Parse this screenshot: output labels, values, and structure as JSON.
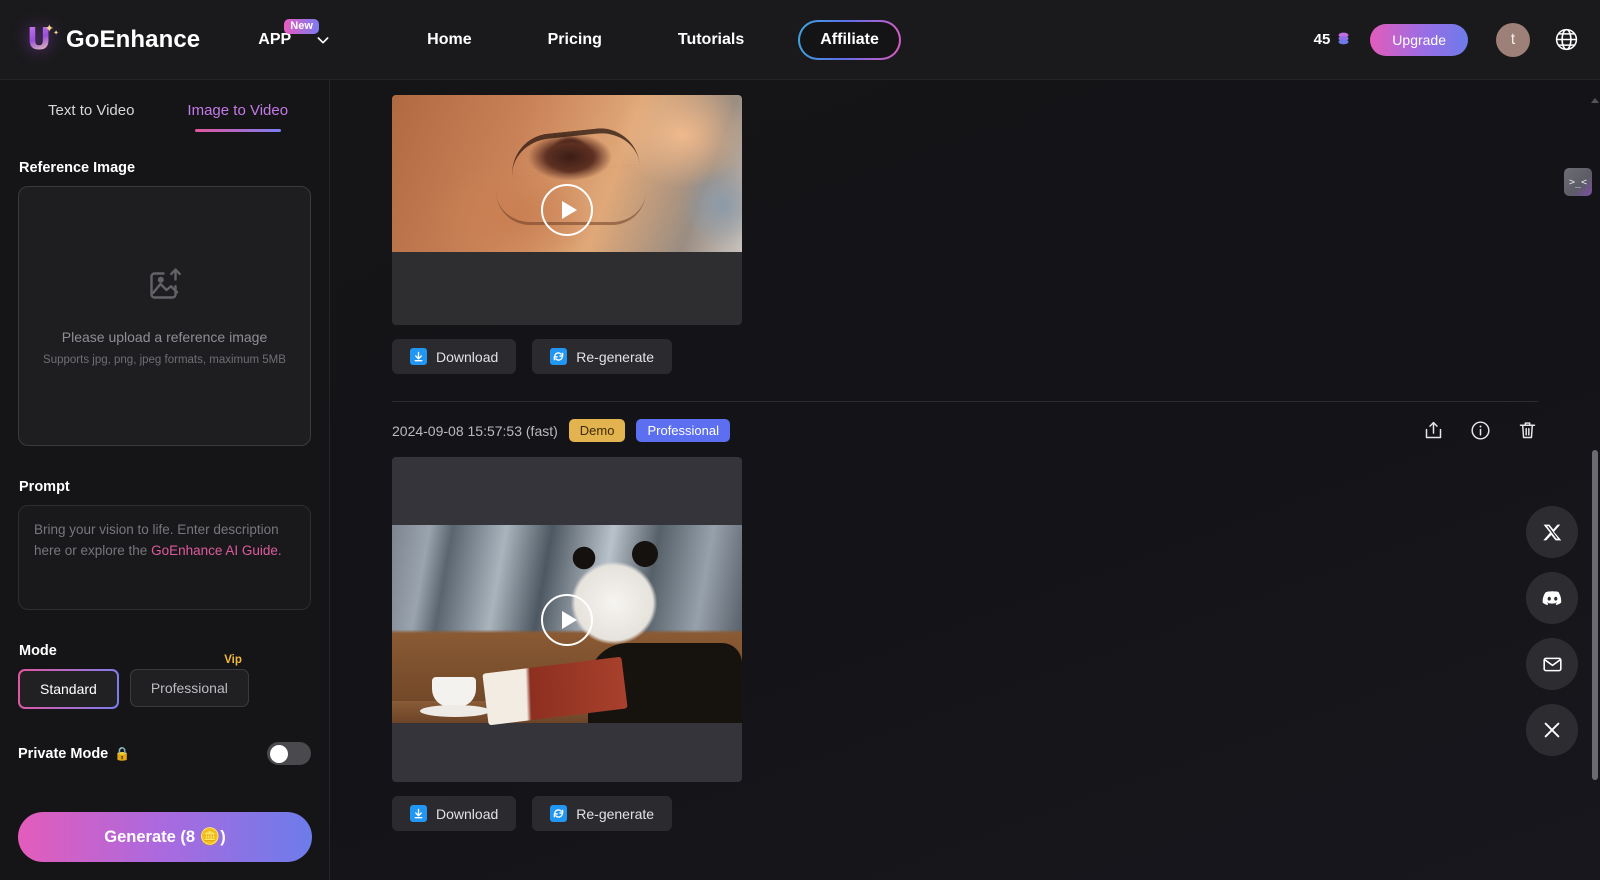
{
  "header": {
    "brand": "GoEnhance",
    "logo_icon": "u-logo-icon",
    "app_label": "APP",
    "app_badge": "New",
    "nav": [
      {
        "label": "Home"
      },
      {
        "label": "Pricing"
      },
      {
        "label": "Tutorials"
      }
    ],
    "affiliate_label": "Affiliate",
    "credits": "45",
    "credits_icon": "coin-stack-icon",
    "upgrade_label": "Upgrade",
    "avatar_initial": "t",
    "globe_icon": "globe-icon",
    "chevron_icon": "chevron-down-icon"
  },
  "sidebar": {
    "tabs": [
      {
        "label": "Text to Video",
        "active": false
      },
      {
        "label": "Image to Video",
        "active": true
      }
    ],
    "reference_image": {
      "title": "Reference Image",
      "icon": "image-upload-icon",
      "main_text": "Please upload a reference image",
      "sub_text": "Supports jpg, png, jpeg formats, maximum 5MB"
    },
    "prompt": {
      "title": "Prompt",
      "placeholder_part1": "Bring your vision to life. Enter description here or explore the ",
      "placeholder_link": "GoEnhance AI Guide."
    },
    "mode": {
      "title": "Mode",
      "options": [
        {
          "label": "Standard",
          "active": true,
          "badge": ""
        },
        {
          "label": "Professional",
          "active": false,
          "badge": "Vip"
        }
      ]
    },
    "private_mode": {
      "label": "Private Mode",
      "icon": "lock-icon",
      "enabled": false
    },
    "generate_label": "Generate (8 🪙)"
  },
  "main": {
    "cards": [
      {
        "thumbnail": "close-up-eye-video",
        "play_icon": "play-icon",
        "actions": [
          {
            "label": "Download",
            "icon": "download-icon"
          },
          {
            "label": "Re-generate",
            "icon": "refresh-icon"
          }
        ]
      },
      {
        "timestamp": "2024-09-08 15:57:53 (fast)",
        "badges": [
          {
            "label": "Demo",
            "kind": "demo"
          },
          {
            "label": "Professional",
            "kind": "professional"
          }
        ],
        "row_icons": [
          {
            "name": "share-icon"
          },
          {
            "name": "info-icon"
          },
          {
            "name": "trash-icon"
          }
        ],
        "thumbnail": "panda-reading-book-video",
        "play_icon": "play-icon",
        "actions": [
          {
            "label": "Download",
            "icon": "download-icon"
          },
          {
            "label": "Re-generate",
            "icon": "refresh-icon"
          }
        ]
      }
    ]
  },
  "floating": {
    "emoji_tab": ">_<",
    "social": [
      {
        "name": "x-twitter-icon"
      },
      {
        "name": "discord-icon"
      },
      {
        "name": "email-icon"
      },
      {
        "name": "close-icon"
      }
    ]
  },
  "colors": {
    "accent_pink": "#e2569f",
    "accent_blue": "#7b7ef0",
    "badge_demo": "#e3b34f",
    "badge_pro": "#5b6ff0",
    "action_icon_blue": "#2196f3",
    "background": "#0f0f12"
  }
}
